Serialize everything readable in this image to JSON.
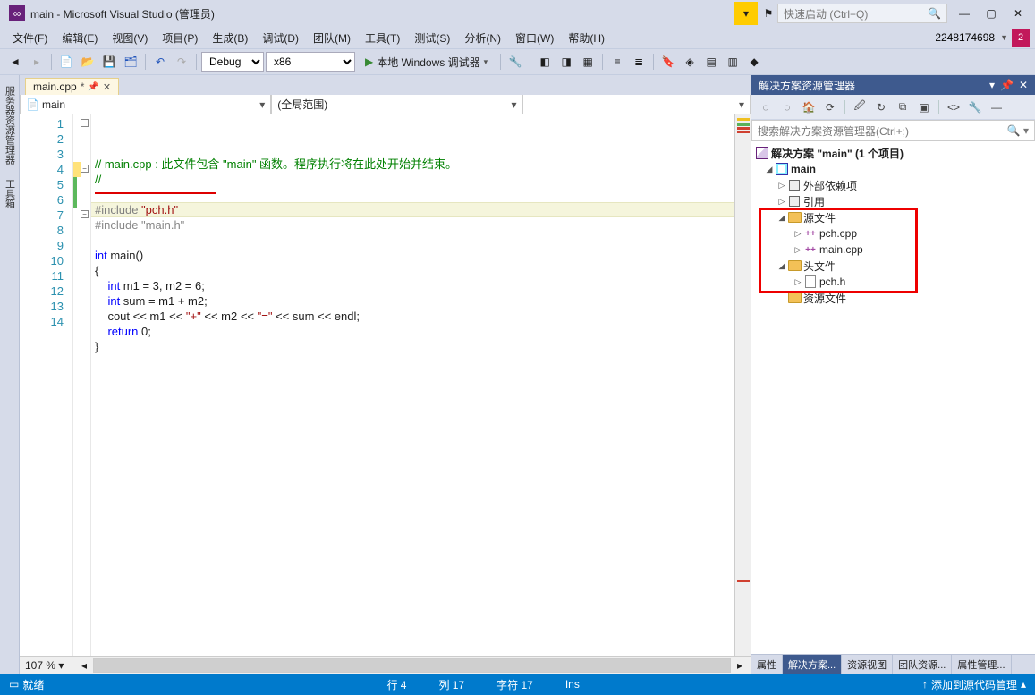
{
  "title": "main - Microsoft Visual Studio  (管理员)",
  "quick_launch_placeholder": "快速启动 (Ctrl+Q)",
  "menu": [
    "文件(F)",
    "编辑(E)",
    "视图(V)",
    "项目(P)",
    "生成(B)",
    "调试(D)",
    "团队(M)",
    "工具(T)",
    "测试(S)",
    "分析(N)",
    "窗口(W)",
    "帮助(H)"
  ],
  "login_id": "2248174698",
  "avatar_initial": "2",
  "toolbar": {
    "config": "Debug",
    "platform": "x86",
    "run_label": "本地 Windows 调试器"
  },
  "leftrail": [
    "服务器资源管理器",
    "工具箱"
  ],
  "tab": {
    "name": "main.cpp",
    "modified": "*"
  },
  "nav": {
    "left_icon": "📄",
    "left": "main",
    "right": "(全局范围)"
  },
  "code": {
    "lines": [
      {
        "n": 1,
        "seg": [
          {
            "t": "// main.cpp : 此文件包含 \"main\" 函数。程序执行将在此处开始并结束。",
            "c": "c-comment"
          }
        ],
        "fold": "-"
      },
      {
        "n": 2,
        "seg": [
          {
            "t": "//",
            "c": "c-comment"
          }
        ]
      },
      {
        "n": 3,
        "seg": []
      },
      {
        "n": 4,
        "seg": [
          {
            "t": "#include ",
            "c": "c-pre"
          },
          {
            "t": "\"pch.h\"",
            "c": "c-str"
          }
        ],
        "fold": "-",
        "current": true,
        "hl": true
      },
      {
        "n": 5,
        "seg": [
          {
            "t": "#include ",
            "c": "c-pre c-dim"
          },
          {
            "t": "\"main.h\"",
            "c": "c-str c-dim"
          }
        ],
        "green": true,
        "under": true
      },
      {
        "n": 6,
        "seg": [],
        "green": true
      },
      {
        "n": 7,
        "seg": [
          {
            "t": "int",
            "c": "c-kw"
          },
          {
            "t": " main()",
            "c": ""
          }
        ],
        "fold": "-"
      },
      {
        "n": 8,
        "seg": [
          {
            "t": "{",
            "c": ""
          }
        ]
      },
      {
        "n": 9,
        "seg": [
          {
            "t": "    ",
            "c": ""
          },
          {
            "t": "int",
            "c": "c-kw"
          },
          {
            "t": " m1 = 3, m2 = 6;",
            "c": ""
          }
        ]
      },
      {
        "n": 10,
        "seg": [
          {
            "t": "    ",
            "c": ""
          },
          {
            "t": "int",
            "c": "c-kw"
          },
          {
            "t": " sum = m1 + m2;",
            "c": ""
          }
        ]
      },
      {
        "n": 11,
        "seg": [
          {
            "t": "    cout << m1 << ",
            "c": ""
          },
          {
            "t": "\"+\"",
            "c": "c-str"
          },
          {
            "t": " << m2 << ",
            "c": ""
          },
          {
            "t": "\"=\"",
            "c": "c-str"
          },
          {
            "t": " << sum << endl;",
            "c": ""
          }
        ]
      },
      {
        "n": 12,
        "seg": [
          {
            "t": "    ",
            "c": ""
          },
          {
            "t": "return",
            "c": "c-kw"
          },
          {
            "t": " 0;",
            "c": ""
          }
        ]
      },
      {
        "n": 13,
        "seg": [
          {
            "t": "}",
            "c": ""
          }
        ]
      },
      {
        "n": 14,
        "seg": []
      }
    ]
  },
  "zoom": "107 %",
  "solution": {
    "panel_title": "解决方案资源管理器",
    "search_placeholder": "搜索解决方案资源管理器(Ctrl+;)",
    "root": "解决方案 \"main\" (1 个项目)",
    "project": "main",
    "ext_deps": "外部依赖项",
    "refs": "引用",
    "src_folder": "源文件",
    "src_files": [
      "pch.cpp",
      "main.cpp"
    ],
    "hdr_folder": "头文件",
    "hdr_files": [
      "pch.h"
    ],
    "res_folder": "资源文件"
  },
  "rp_tabs": [
    "属性",
    "解决方案...",
    "资源视图",
    "团队资源...",
    "属性管理..."
  ],
  "status": {
    "ready": "就绪",
    "line": "行 4",
    "col": "列 17",
    "char": "字符 17",
    "ins": "Ins",
    "scm": "添加到源代码管理"
  }
}
